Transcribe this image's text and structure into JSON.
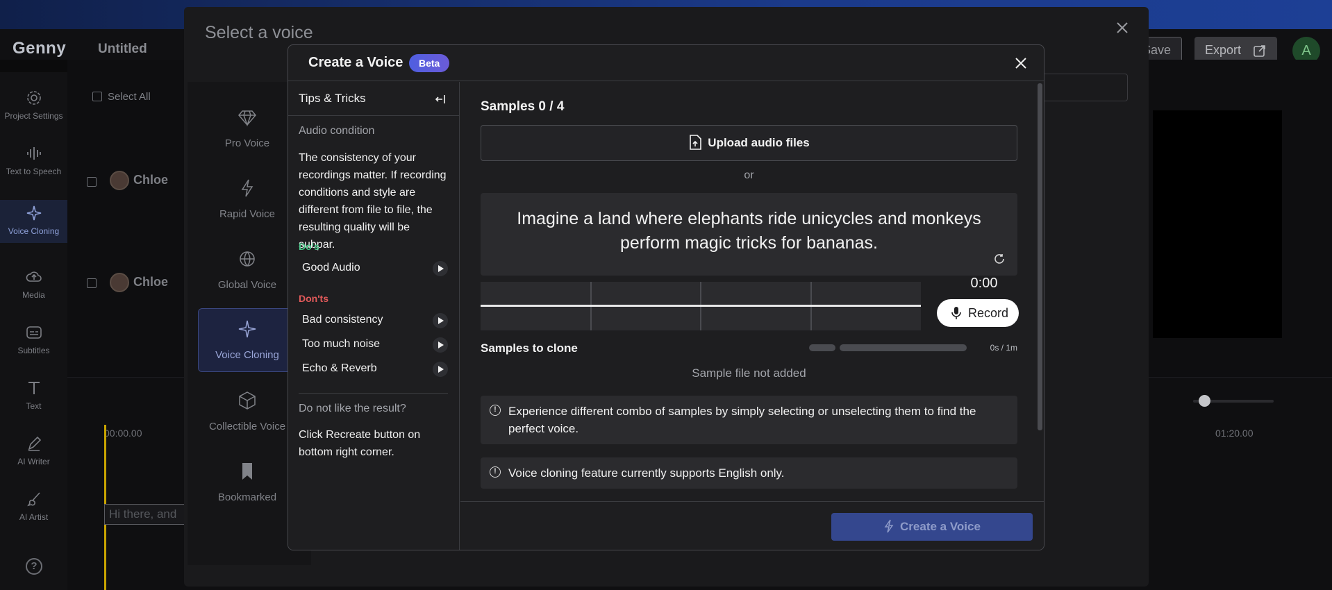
{
  "app": {
    "logo": "Genny",
    "project_title": "Untitled",
    "save_label": "Save",
    "export_label": "Export",
    "avatar_initial": "A"
  },
  "rail": [
    {
      "label": "Project Settings",
      "icon": "gear-icon"
    },
    {
      "label": "Text to Speech",
      "icon": "waveform-icon"
    },
    {
      "label": "Voice Cloning",
      "icon": "sparkle-icon",
      "active": true
    },
    {
      "label": "Media",
      "icon": "cloud-upload-icon"
    },
    {
      "label": "Subtitles",
      "icon": "subtitles-icon"
    },
    {
      "label": "Text",
      "icon": "text-icon"
    },
    {
      "label": "AI Writer",
      "icon": "pen-icon"
    },
    {
      "label": "AI Artist",
      "icon": "brush-icon"
    }
  ],
  "background": {
    "select_all": "Select All",
    "voice_rows": [
      "Chloe",
      "Chloe"
    ],
    "timeline_start": "00:00.00",
    "timeline_end": "01:20.00",
    "text_clip": "Hi there, and"
  },
  "outer_modal": {
    "title": "Select a voice",
    "voice_types": [
      {
        "label": "Pro Voice",
        "icon": "diamond-icon"
      },
      {
        "label": "Rapid Voice",
        "icon": "bolt-icon"
      },
      {
        "label": "Global Voice",
        "icon": "globe-translate-icon"
      },
      {
        "label": "Voice Cloning",
        "icon": "sparkle-icon",
        "active": true
      },
      {
        "label": "Collectible Voice",
        "icon": "cube-icon"
      },
      {
        "label": "Bookmarked",
        "icon": "bookmark-icon"
      }
    ]
  },
  "dialog": {
    "title": "Create a Voice",
    "badge": "Beta",
    "tips": {
      "heading": "Tips & Tricks",
      "audio_condition_label": "Audio condition",
      "audio_condition_text": "The consistency of your recordings matter. If recording conditions and style are different from file to file, the resulting quality will be subpar.",
      "dos_label": "Do's",
      "dos": [
        "Good Audio"
      ],
      "donts_label": "Don'ts",
      "donts": [
        "Bad consistency",
        "Too much noise",
        "Echo & Reverb"
      ],
      "dislike_label": "Do not like the result?",
      "dislike_text": "Click Recreate button on bottom right corner."
    },
    "samples": {
      "count_label": "Samples 0 / 4",
      "upload_label": "Upload audio files",
      "or_label": "or",
      "script_text": "Imagine a land where elephants ride unicycles and monkeys perform magic tricks for bananas.",
      "timer": "0:00",
      "record_label": "Record",
      "to_clone_label": "Samples to clone",
      "duration_label": "0s / 1m",
      "not_added_label": "Sample file not added",
      "info_combo": "Experience different combo of samples by simply selecting or unselecting them to find the perfect voice.",
      "info_english": "Voice cloning feature currently supports English only."
    },
    "create_label": "Create a Voice"
  }
}
